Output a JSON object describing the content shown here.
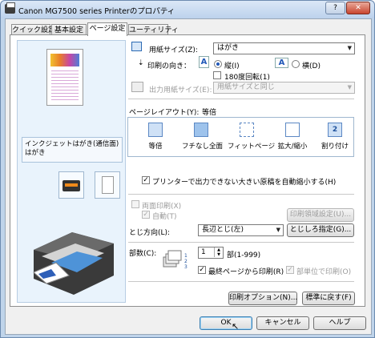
{
  "window": {
    "title": "Canon MG7500 series Printerのプロパティ"
  },
  "tabs": [
    {
      "label": "クイック設定"
    },
    {
      "label": "基本設定"
    },
    {
      "label": "ページ設定"
    },
    {
      "label": "ユーティリティ"
    }
  ],
  "preview": {
    "media_text": "インクジェットはがき(通信面)\nはがき"
  },
  "page_size": {
    "label": "用紙サイズ(Z):",
    "value": "はがき"
  },
  "orientation": {
    "label": "印刷の向き：",
    "portrait_label": "縦(I)",
    "landscape_label": "横(D)",
    "rotate_label": "180度回転(1)",
    "selected": "portrait"
  },
  "output_size": {
    "label": "出力用紙サイズ(E):",
    "value": "用紙サイズと同じ"
  },
  "page_layout": {
    "label": "ページレイアウト(Y):",
    "current": "等倍",
    "options": [
      "等倍",
      "フチなし全面",
      "フィットページ",
      "拡大/縮小",
      "割り付け"
    ],
    "selected": 0
  },
  "shrink_checkbox": {
    "label": "プリンターで出力できない大きい原稿を自動縮小する(H)",
    "checked": true
  },
  "duplex": {
    "label": "両面印刷(X)",
    "auto_label": "自動(T)",
    "area_button": "印刷領域設定(U)...",
    "binding_label": "とじ方向(L):",
    "binding_value": "長辺とじ(左)",
    "margin_button": "とじしろ指定(G)..."
  },
  "copies": {
    "label": "部数(C):",
    "value": "1",
    "range": "部(1-999)",
    "last_page_first": "最終ページから印刷(R)",
    "collate": "部単位で印刷(O)"
  },
  "buttons": {
    "print_options": "印刷オプション(N)...",
    "defaults": "標準に戻す(F)",
    "ok": "OK",
    "cancel": "キャンセル",
    "help": "ヘルプ"
  },
  "colors": {
    "accent": "#2258b8",
    "tab_active": "#ffffff",
    "preview_bg": "#e9f3fc"
  }
}
